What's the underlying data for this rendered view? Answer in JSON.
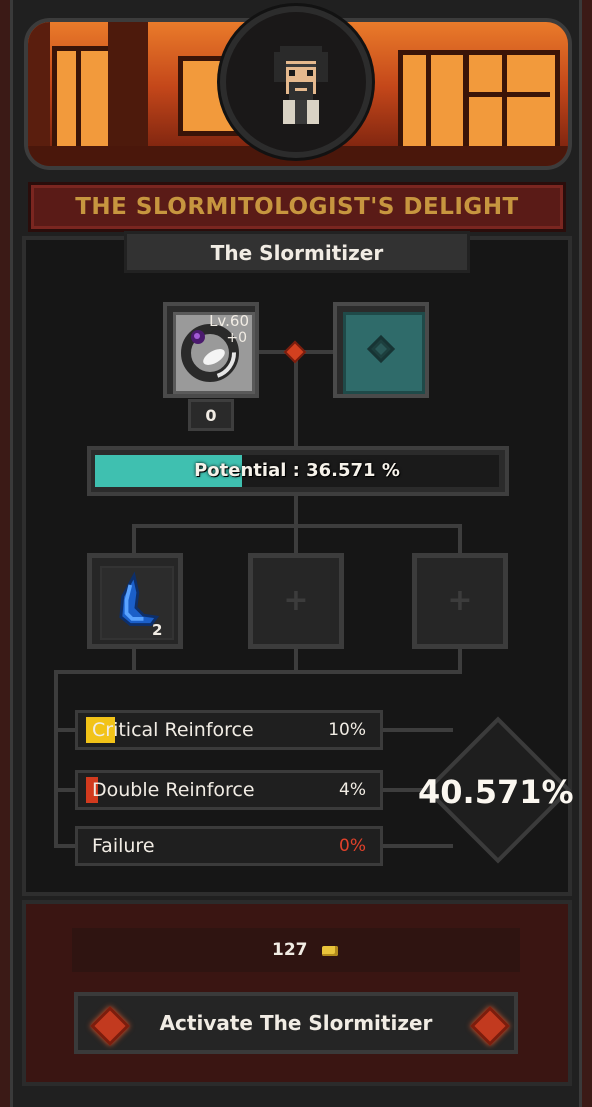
{
  "panel": {
    "title": "THE SLORMITOLOGIST'S DELIGHT",
    "subtitle": "The Slormitizer"
  },
  "item": {
    "level": "Lv.60",
    "upgrade": "+0",
    "count": "0",
    "icon": "ring-icon"
  },
  "target": {
    "icon": "dark-gem-icon"
  },
  "potential": {
    "text": "Potential : 36.571 %",
    "fill_fraction": 0.365
  },
  "materials": [
    {
      "icon": "blue-crescent-shard-icon",
      "count": "2"
    },
    {
      "icon": "plus-icon",
      "count": ""
    },
    {
      "icon": "plus-icon",
      "count": ""
    }
  ],
  "reinforce": [
    {
      "label": "Critical Reinforce",
      "value": "10%",
      "indicator_color": "#f2c318",
      "fill_fraction": 0.1
    },
    {
      "label": "Double Reinforce",
      "value": "4%",
      "indicator_color": "#d23a1e",
      "fill_fraction": 0.04
    },
    {
      "label": "Failure",
      "value": "0%",
      "value_color": "#e0412a"
    }
  ],
  "total": "40.571%",
  "cost": {
    "amount": "127",
    "icon": "gold-coin-icon"
  },
  "activate_label": "Activate The Slormitizer",
  "colors": {
    "potential_fill": "#3fc0b0",
    "title_text": "#c7963f",
    "panel_red": "#5a1b17"
  }
}
